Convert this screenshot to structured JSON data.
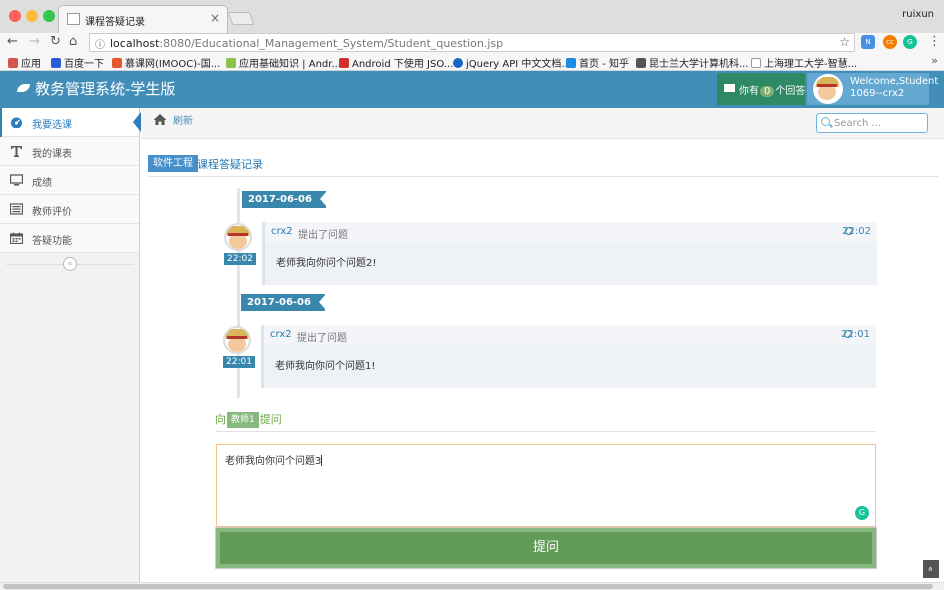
{
  "browser": {
    "tab_title": "课程答疑记录",
    "tab_close": "×",
    "profile": "ruixun",
    "url_host": "localhost",
    "url_rest": ":8080/Educational_Management_System/Student_question.jsp",
    "back": "←",
    "forward": "→",
    "reload": "↻",
    "home": "⌂",
    "star": "☆",
    "menu": "⋮",
    "bookmarks": [
      {
        "label": "应用",
        "color": "#d9534f"
      },
      {
        "label": "百度一下",
        "color": "#2c5cd6"
      },
      {
        "label": "慕课网(IMOOC)-国...",
        "color": "#e4572e"
      },
      {
        "label": "应用基础知识 | Andr...",
        "color": "#8bc34a"
      },
      {
        "label": "Android 下使用 JSO...",
        "color": "#d32f2f"
      },
      {
        "label": "jQuery API 中文文档...",
        "color": "#1565c0"
      },
      {
        "label": "首页 - 知乎",
        "color": "#1e88e5"
      },
      {
        "label": "昆士兰大学计算机科...",
        "color": "#555555"
      },
      {
        "label": "上海理工大学-智慧...",
        "color": "#9e9e9e"
      }
    ],
    "bookmarks_more": "»"
  },
  "header": {
    "brand": "教务管理系统-学生版",
    "notif_prefix": "你有",
    "notif_count": "0",
    "notif_suffix": "个回答",
    "welcome": "Welcome,Student",
    "user_id": "1069--crx2"
  },
  "sidebar": {
    "items": [
      {
        "label": "我要选课",
        "icon": "dashboard-icon"
      },
      {
        "label": "我的课表",
        "icon": "text-icon"
      },
      {
        "label": "成绩",
        "icon": "desktop-icon"
      },
      {
        "label": "教师评价",
        "icon": "list-icon"
      },
      {
        "label": "答疑功能",
        "icon": "calendar-icon"
      }
    ],
    "collapse": "«"
  },
  "breadcrumbs": {
    "refresh": "刷新",
    "search_placeholder": "Search ..."
  },
  "page": {
    "course": "软件工程",
    "title": "课程答疑记录"
  },
  "timeline": [
    {
      "date": "2017-06-06",
      "time_tag": "22:02",
      "user": "crx2",
      "action": "提出了问题",
      "time": "22:02",
      "body": "老师我向你问个问题2!"
    },
    {
      "date": "2017-06-06",
      "time_tag": "22:01",
      "user": "crx2",
      "action": "提出了问题",
      "time": "22:01",
      "body": "老师我向你问个问题1!"
    }
  ],
  "ask": {
    "prefix": "向",
    "teacher": "教师1",
    "suffix": "提问",
    "textarea_value": "老师我向你问个问题3",
    "submit": "提问"
  },
  "colors": {
    "header": "#438eb9",
    "accent": "#2679b5",
    "submit": "#629b58"
  }
}
